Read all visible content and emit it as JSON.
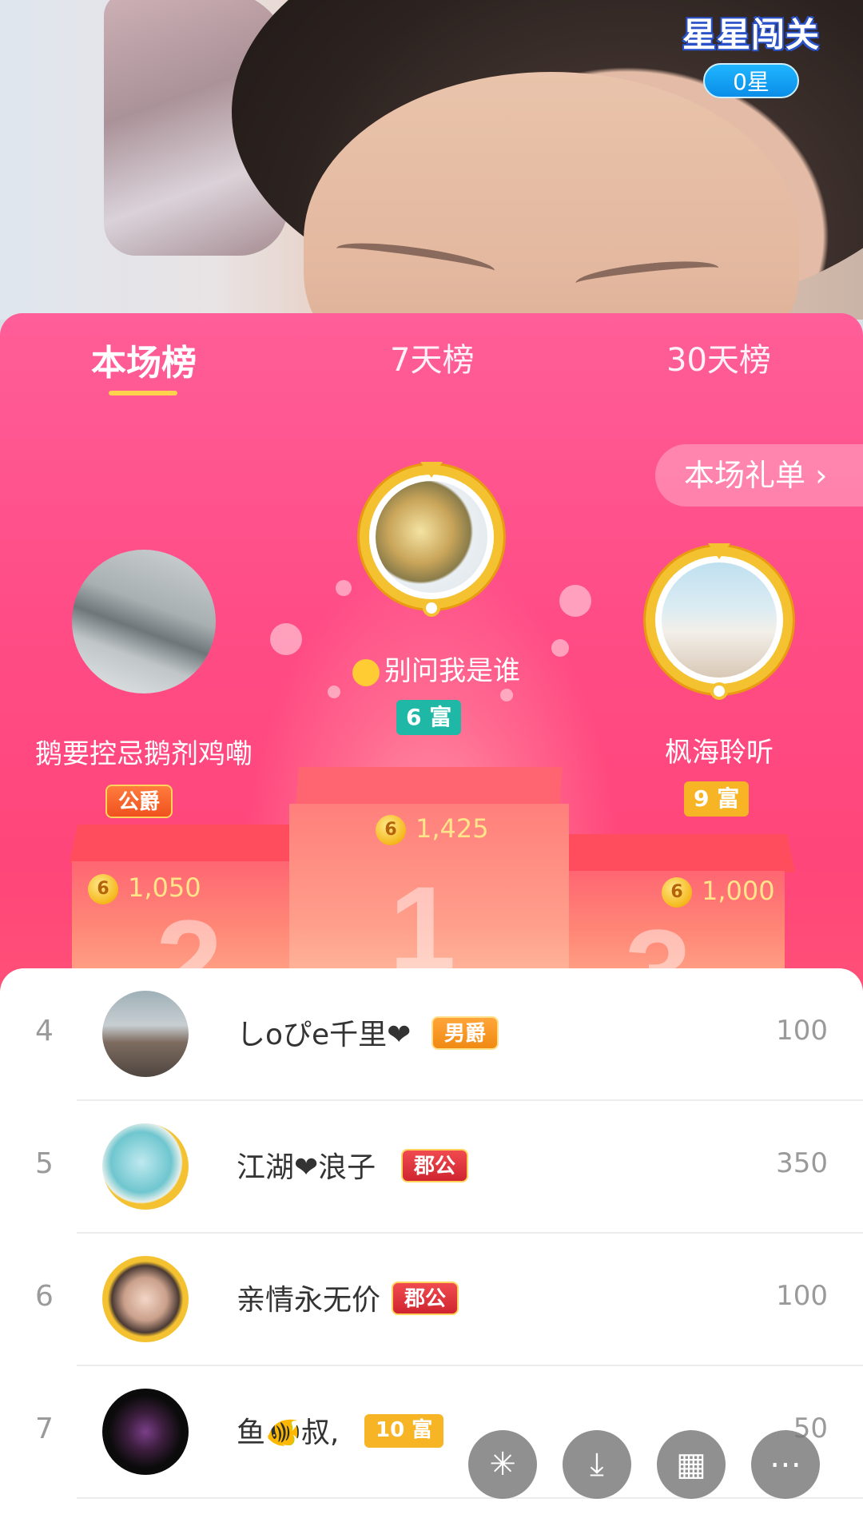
{
  "stream": {
    "game_badge": {
      "title": "星星闯关",
      "stars": "0星"
    }
  },
  "ranking": {
    "tabs": [
      {
        "label": "本场榜",
        "active": true
      },
      {
        "label": "7天榜",
        "active": false
      },
      {
        "label": "30天榜",
        "active": false
      }
    ],
    "gift_list_button": "本场礼单 ›",
    "podium": [
      {
        "place": "1",
        "name": "别问我是谁",
        "badge": "6 富",
        "badge_type": "rich",
        "score": "1,425"
      },
      {
        "place": "2",
        "name": "鹅要控忌鹅剂鸡嘞",
        "badge": "公爵",
        "badge_type": "noble",
        "score": "1,050"
      },
      {
        "place": "3",
        "name": "枫海聆听",
        "badge": "9 富",
        "badge_type": "rich",
        "score": "1,000"
      }
    ],
    "coin_symbol": "6"
  },
  "list": [
    {
      "rank": "4",
      "name": "しoぴe千里❤",
      "badge": "男爵",
      "score": "100"
    },
    {
      "rank": "5",
      "name": "江湖❤浪子",
      "badge": "郡公",
      "score": "350"
    },
    {
      "rank": "6",
      "name": "亲情永无价",
      "badge": "郡公",
      "score": "100"
    },
    {
      "rank": "7",
      "name": "鱼🐠叔,",
      "badge": "10 富",
      "score": "50"
    }
  ],
  "fab_icons": [
    "share-icon",
    "download-icon",
    "grid-icon",
    "more-icon"
  ],
  "colors": {
    "panel_pink": "#ff4c86",
    "rich_badge_teal": "#1fb8a6",
    "rich_badge_gold": "#f7b526",
    "noble_orange": "#f0521e",
    "noble_red": "#e8353f"
  }
}
